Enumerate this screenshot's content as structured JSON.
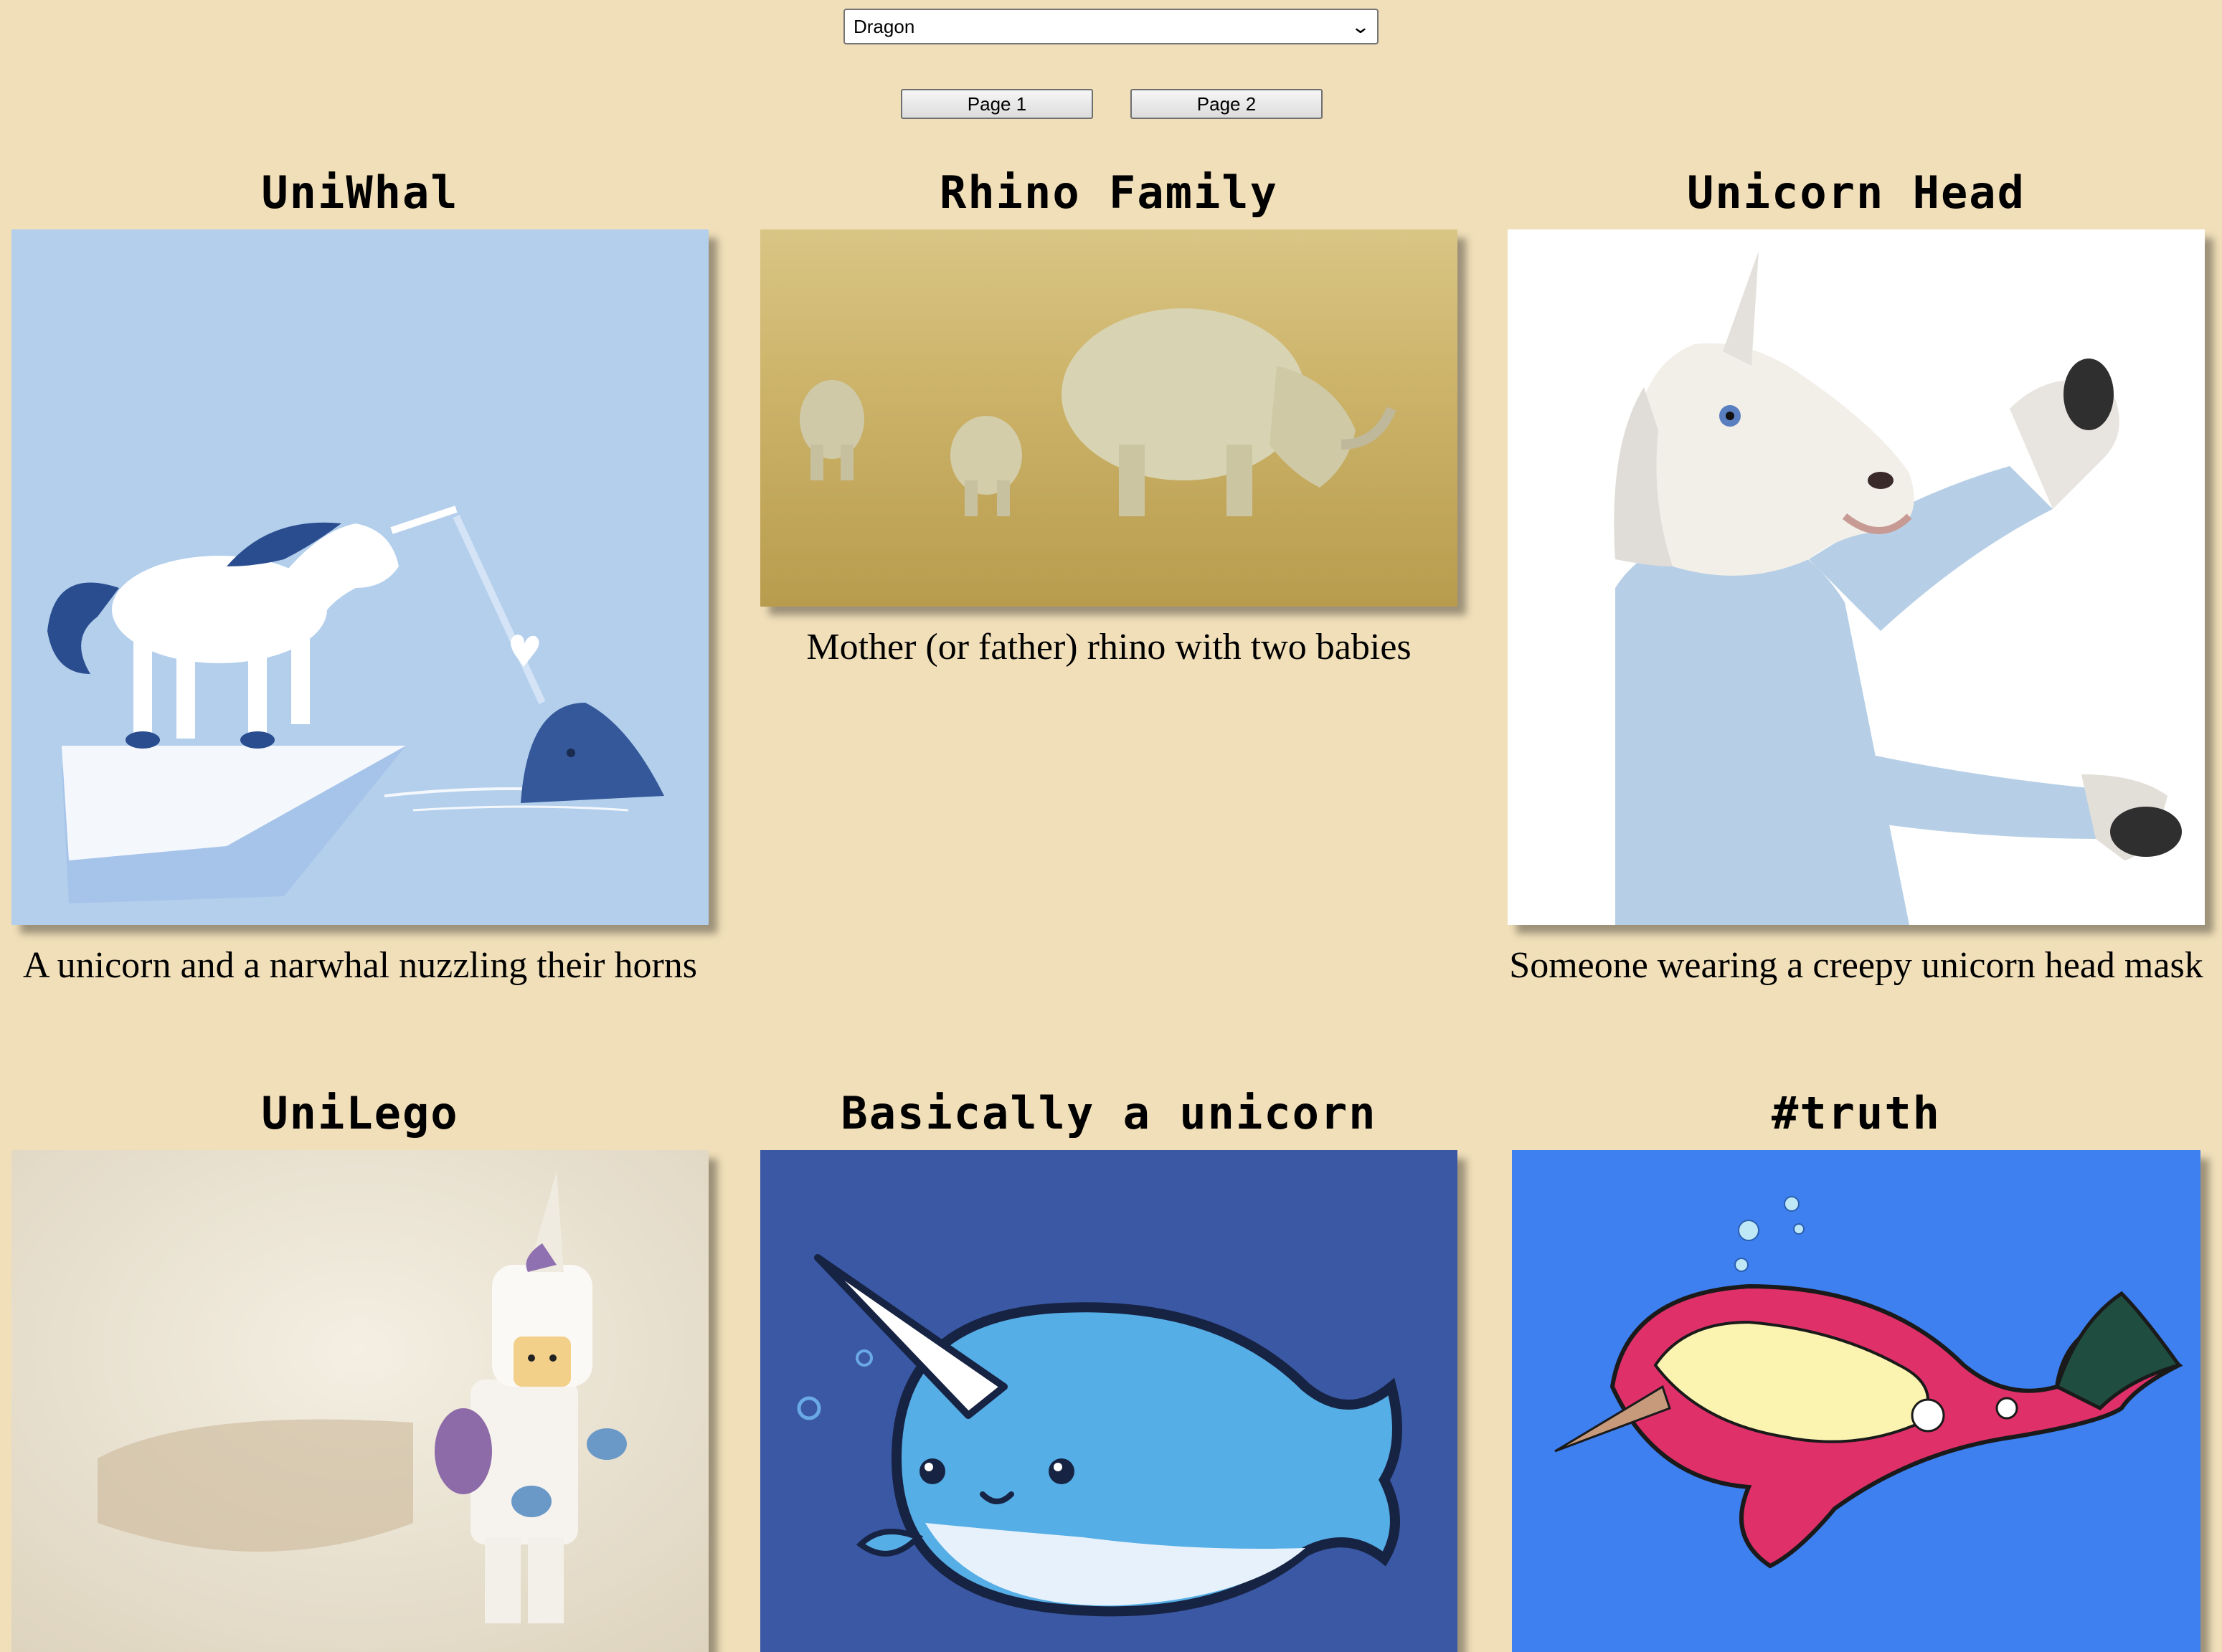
{
  "filter": {
    "selected": "Dragon"
  },
  "pagination": {
    "page1_label": "Page 1",
    "page2_label": "Page 2"
  },
  "cards": [
    {
      "title": "UniWhal",
      "caption": "A unicorn and a narwhal nuzzling their horns",
      "bg": "#b3cfec"
    },
    {
      "title": "Rhino Family",
      "caption": "Mother (or father) rhino with two babies",
      "bg": "#cdb978"
    },
    {
      "title": "Unicorn Head",
      "caption": "Someone wearing a creepy unicorn head mask",
      "bg": "#ffffff"
    },
    {
      "title": "UniLego",
      "caption": "",
      "bg": "#ece6d6"
    },
    {
      "title": "Basically a unicorn",
      "caption": "",
      "bg": "#3a58a4"
    },
    {
      "title": "#truth",
      "caption": "",
      "bg": "#3e80f0"
    }
  ]
}
